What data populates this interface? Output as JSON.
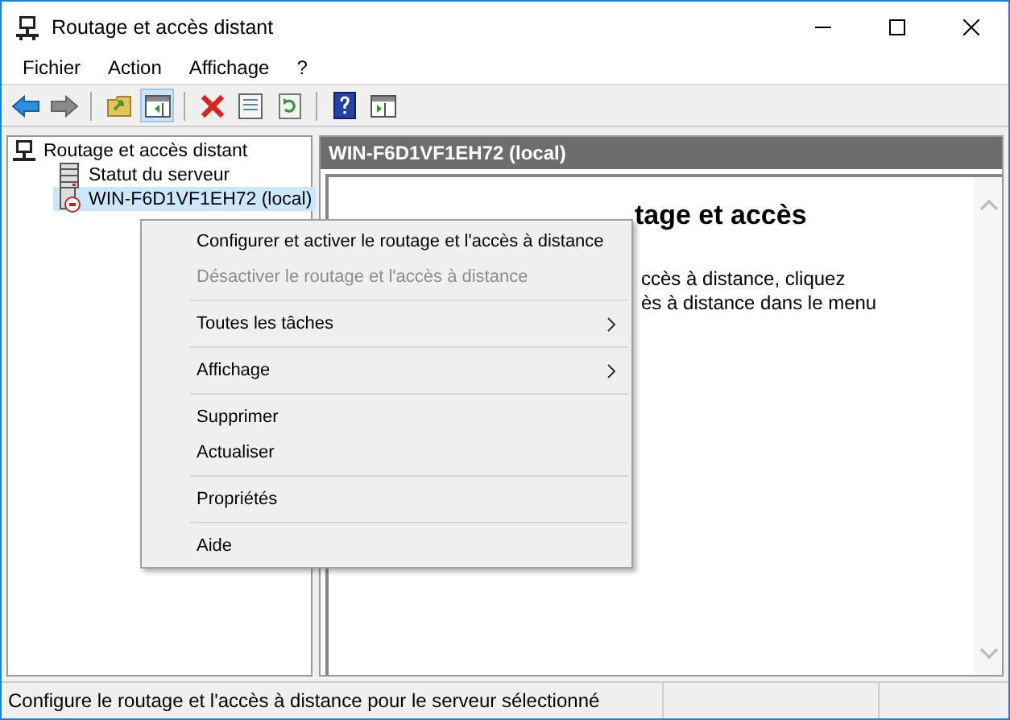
{
  "window": {
    "title": "Routage et accès distant"
  },
  "menubar": [
    "Fichier",
    "Action",
    "Affichage",
    "?"
  ],
  "toolbar": [
    {
      "kind": "back",
      "selected": false
    },
    {
      "kind": "forward",
      "selected": false
    },
    {
      "kind": "sep"
    },
    {
      "kind": "up",
      "selected": false
    },
    {
      "kind": "tree",
      "selected": true
    },
    {
      "kind": "sep"
    },
    {
      "kind": "delete",
      "selected": false
    },
    {
      "kind": "properties",
      "selected": false
    },
    {
      "kind": "refresh",
      "selected": false
    },
    {
      "kind": "sep"
    },
    {
      "kind": "help",
      "selected": false
    },
    {
      "kind": "actionpane",
      "selected": false
    }
  ],
  "tree": [
    {
      "label": "Routage et accès distant",
      "kind": "root",
      "selected": false,
      "children": [
        {
          "label": "Statut du serveur",
          "kind": "status",
          "selected": false
        },
        {
          "label": "WIN-F6D1VF1EH72 (local)",
          "kind": "server",
          "selected": true
        }
      ]
    }
  ],
  "details": {
    "header": "WIN-F6D1VF1EH72 (local)",
    "heading": "tage et accès",
    "lines": [
      "ccès à distance, cliquez",
      "ès à distance dans le menu"
    ]
  },
  "context_menu": [
    {
      "kind": "item",
      "label": "Configurer et activer le routage et l'accès à distance",
      "disabled": false,
      "submenu": false
    },
    {
      "kind": "item",
      "label": "Désactiver le routage et l'accès à distance",
      "disabled": true,
      "submenu": false
    },
    {
      "kind": "separator"
    },
    {
      "kind": "item",
      "label": "Toutes les tâches",
      "disabled": false,
      "submenu": true
    },
    {
      "kind": "separator"
    },
    {
      "kind": "item",
      "label": "Affichage",
      "disabled": false,
      "submenu": true
    },
    {
      "kind": "separator"
    },
    {
      "kind": "item",
      "label": "Supprimer",
      "disabled": false,
      "submenu": false
    },
    {
      "kind": "item",
      "label": "Actualiser",
      "disabled": false,
      "submenu": false
    },
    {
      "kind": "separator"
    },
    {
      "kind": "item",
      "label": "Propriétés",
      "disabled": false,
      "submenu": false
    },
    {
      "kind": "separator"
    },
    {
      "kind": "item",
      "label": "Aide",
      "disabled": false,
      "submenu": false
    }
  ],
  "status_bar": "Configure le routage et l'accès à distance pour le serveur sélectionné"
}
